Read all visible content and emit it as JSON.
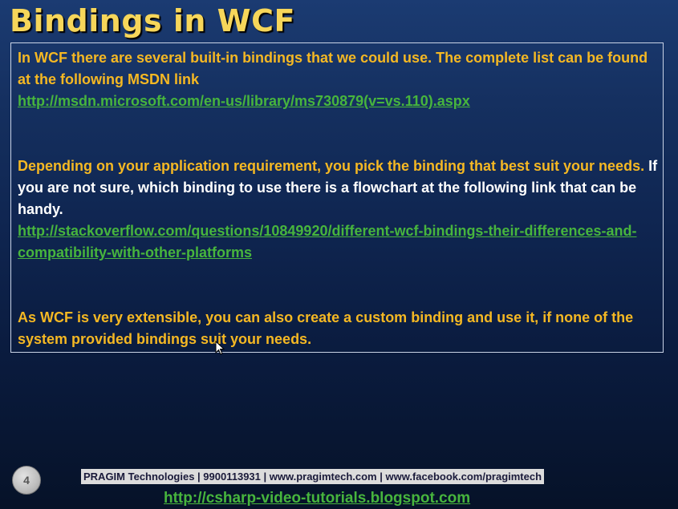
{
  "slide": {
    "title": "Bindings in WCF",
    "page_number": "4"
  },
  "content": {
    "para1_text": "In WCF there are several built-in bindings that we could use. The complete list can be found at the following MSDN link",
    "para1_link": "http://msdn.microsoft.com/en-us/library/ms730879(v=vs.110).aspx",
    "para2_orange": "Depending on your application requirement, you pick the binding that best suit your needs.",
    "para2_white": "If you are not sure, which binding to use there is a flowchart at the following link that can be handy.",
    "para2_link": "http://stackoverflow.com/questions/10849920/different-wcf-bindings-their-differences-and-compatibility-with-other-platforms",
    "para3_text": "As WCF is very extensible, you can also create a custom binding and use it, if none of the system provided bindings suit your needs."
  },
  "footer": {
    "banner": "PRAGIM Technologies | 9900113931 | www.pragimtech.com | www.facebook.com/pragimtech",
    "blog_link": "http://csharp-video-tutorials.blogspot.com"
  },
  "colors": {
    "title": "#f6d65a",
    "orange_text": "#f5b823",
    "link": "#47b53d",
    "background_top": "#1b3b72",
    "background_bottom": "#061228"
  }
}
